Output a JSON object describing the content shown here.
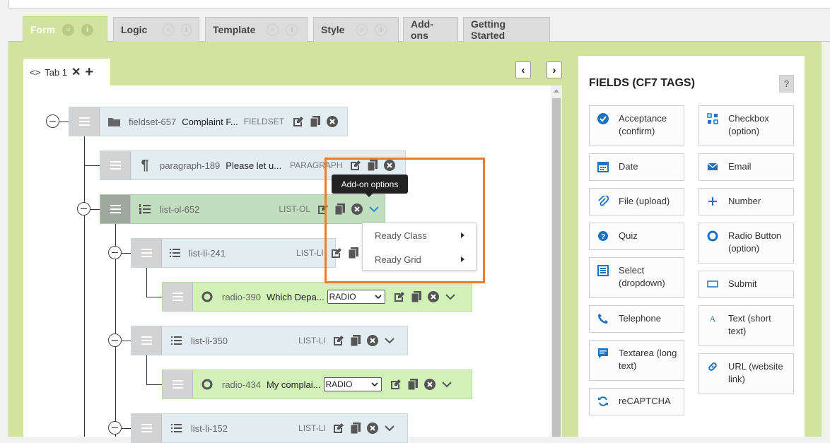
{
  "tabs": [
    {
      "label": "Form",
      "active": true
    },
    {
      "label": "Logic"
    },
    {
      "label": "Template"
    },
    {
      "label": "Style"
    },
    {
      "label": "Add-ons"
    },
    {
      "label": "Getting Started"
    }
  ],
  "editor_tab": {
    "label": "Tab 1"
  },
  "nodes": {
    "fieldset": {
      "name": "fieldset-657",
      "label": "Complaint F...",
      "type": "FIELDSET"
    },
    "paragraph": {
      "name": "paragraph-189",
      "label": "Please let u...",
      "type": "PARAGRAPH"
    },
    "list_ol": {
      "name": "list-ol-652",
      "label": "",
      "type": "LIST-OL"
    },
    "list_li_241": {
      "name": "list-li-241",
      "type": "LIST-LI"
    },
    "radio_390": {
      "name": "radio-390",
      "label": "Which Depa...",
      "select": "RADIO"
    },
    "list_li_350": {
      "name": "list-li-350",
      "type": "LIST-LI"
    },
    "radio_434": {
      "name": "radio-434",
      "label": "My complai...",
      "select": "RADIO"
    },
    "list_li_152": {
      "name": "list-li-152",
      "type": "LIST-LI"
    }
  },
  "tooltip": {
    "text": "Add-on options"
  },
  "dropdown": {
    "items": [
      "Ready Class",
      "Ready Grid"
    ]
  },
  "fields_panel": {
    "title": "FIELDS (CF7 TAGS)",
    "help": "?",
    "left": [
      {
        "line1": "Acceptance",
        "line2": "(confirm)",
        "icon": "check-circle-icon"
      },
      {
        "line1": "Date",
        "icon": "calendar-icon"
      },
      {
        "line1": "File (upload)",
        "icon": "paperclip-icon"
      },
      {
        "line1": "Quiz",
        "icon": "question-circle-icon"
      },
      {
        "line1": "Select",
        "line2": "(dropdown)",
        "icon": "list-icon"
      },
      {
        "line1": "Telephone",
        "icon": "phone-icon"
      },
      {
        "line1": "Textarea (long",
        "line2": "text)",
        "icon": "textarea-icon"
      },
      {
        "line1": "reCAPTCHA",
        "icon": "refresh-icon"
      }
    ],
    "right": [
      {
        "line1": "Checkbox",
        "line2": "(option)",
        "icon": "checkbox-grid-icon"
      },
      {
        "line1": "Email",
        "icon": "envelope-icon"
      },
      {
        "line1": "Number",
        "icon": "plus-icon"
      },
      {
        "line1": "Radio Button",
        "line2": "(option)",
        "icon": "radio-icon"
      },
      {
        "line1": "Submit",
        "icon": "submit-icon"
      },
      {
        "line1": "Text (short",
        "line2": "text)",
        "icon": "text-icon"
      },
      {
        "line1": "URL (website",
        "line2": "link)",
        "icon": "link-icon"
      }
    ]
  },
  "colors": {
    "accent_green": "#d1e39e",
    "highlight": "#f07d24",
    "field_icon": "#1e73be"
  }
}
